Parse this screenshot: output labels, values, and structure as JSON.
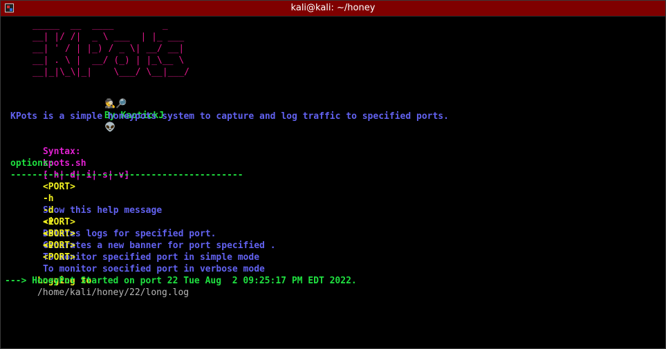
{
  "window": {
    "title": "kali@kali: ~/honey"
  },
  "banner": {
    "lines": [
      "_____  __  ____         _",
      "__| |/ /|  _ \\ ___  | |_ ___",
      "__| ' / | |_) / _ \\| __/ __|",
      "__| . \\ |  __/ (_) | |_\\__ \\",
      "__|_|\\_\\|_|    \\___/ \\__|___/"
    ],
    "author_emoji": "🕵🔎",
    "author": "By KaotickJ",
    "alien_emoji": "👽"
  },
  "description": "KPots is a simple honeypots system to capture and log traffic to specified ports.",
  "syntax": {
    "label": "Syntax:",
    "command": "kpots.sh",
    "flags": "[-h|-d|-i|-s|-v]",
    "arg": "<PORT>"
  },
  "options": {
    "heading": "options:",
    "divider": "-------------------------------------------",
    "items": [
      {
        "flag": "-h",
        "arg": "",
        "desc": "Show this help message"
      },
      {
        "flag": "-d",
        "arg": "<PORT>",
        "desc": "Deletes logs for specified port."
      },
      {
        "flag": "-i",
        "arg": "<PORT>",
        "desc": "Generates a new banner for port specified ."
      },
      {
        "flag": "-S",
        "arg": "<PORT>",
        "desc": "To monitor specified port in simple mode"
      },
      {
        "flag": "-v",
        "arg": "<PORT>",
        "desc": "To monitor soecified port in verbose mode"
      }
    ]
  },
  "logging": {
    "label": "Logging to",
    "path": "/home/kali/honey/22/long.log"
  },
  "status": "---> HoneyPot Started on port 22 Tue Aug  2 09:25:17 PM EDT 2022.",
  "colors": {
    "titlebar": "#7f0000",
    "banner": "#e0188a",
    "green": "#1fe040",
    "blue": "#6262f0",
    "magenta": "#e020d0",
    "yellow": "#f0f020"
  }
}
